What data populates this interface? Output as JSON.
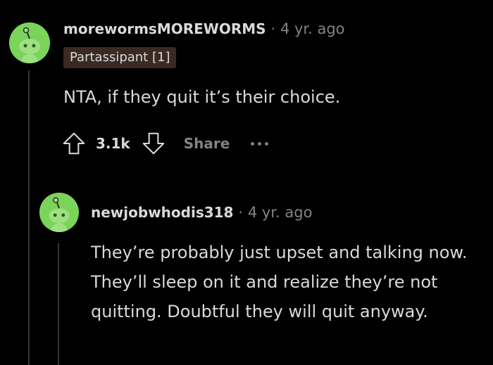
{
  "comment": {
    "username": "morewormsMOREWORMS",
    "separator": "·",
    "age": "4 yr. ago",
    "flair": "Partassipant [1]",
    "text": "NTA, if they quit it’s their choice.",
    "votes": "3.1k",
    "share_label": "Share"
  },
  "reply": {
    "username": "newjobwhodis318",
    "separator": "·",
    "age": "4 yr. ago",
    "text": "They’re probably just upset and talking now. They’ll sleep on it and realize they’re not quitting. Doubtful they will quit anyway."
  },
  "colors": {
    "background": "#000000",
    "avatar": "#7bd45a",
    "flair_bg": "#3a2a22",
    "muted": "#818384",
    "text": "#d7dadc"
  },
  "icons": {
    "upvote": "arrow-up-outline",
    "downvote": "arrow-down-outline",
    "more": "three-dots-horizontal",
    "avatar": "snoo-head"
  }
}
